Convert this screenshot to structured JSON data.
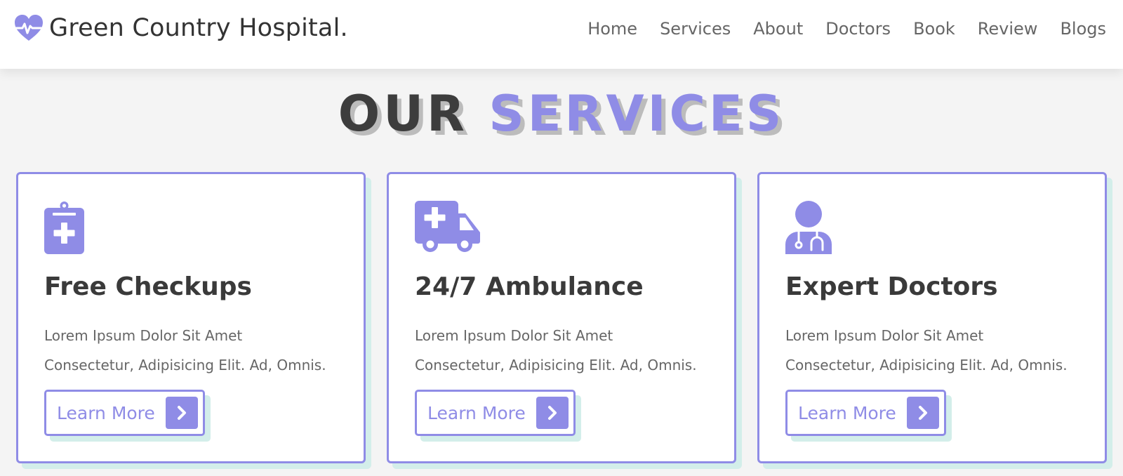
{
  "brand": {
    "name": "Green Country Hospital.",
    "icon": "heartbeat-icon",
    "accent_color": "#8f8ce6"
  },
  "nav": {
    "items": [
      "Home",
      "Services",
      "About",
      "Doctors",
      "Book",
      "Review",
      "Blogs"
    ]
  },
  "section": {
    "heading_word1": "OUR",
    "heading_word2": "SERVICES"
  },
  "services": [
    {
      "icon": "clipboard-medical-icon",
      "title": "Free Checkups",
      "line1": "Lorem Ipsum Dolor Sit Amet",
      "line2": "Consectetur, Adipisicing Elit. Ad, Omnis.",
      "button": "Learn More"
    },
    {
      "icon": "ambulance-icon",
      "title": "24/7 Ambulance",
      "line1": "Lorem Ipsum Dolor Sit Amet",
      "line2": "Consectetur, Adipisicing Elit. Ad, Omnis.",
      "button": "Learn More"
    },
    {
      "icon": "doctor-icon",
      "title": "Expert Doctors",
      "line1": "Lorem Ipsum Dolor Sit Amet",
      "line2": "Consectetur, Adipisicing Elit. Ad, Omnis.",
      "button": "Learn More"
    }
  ]
}
